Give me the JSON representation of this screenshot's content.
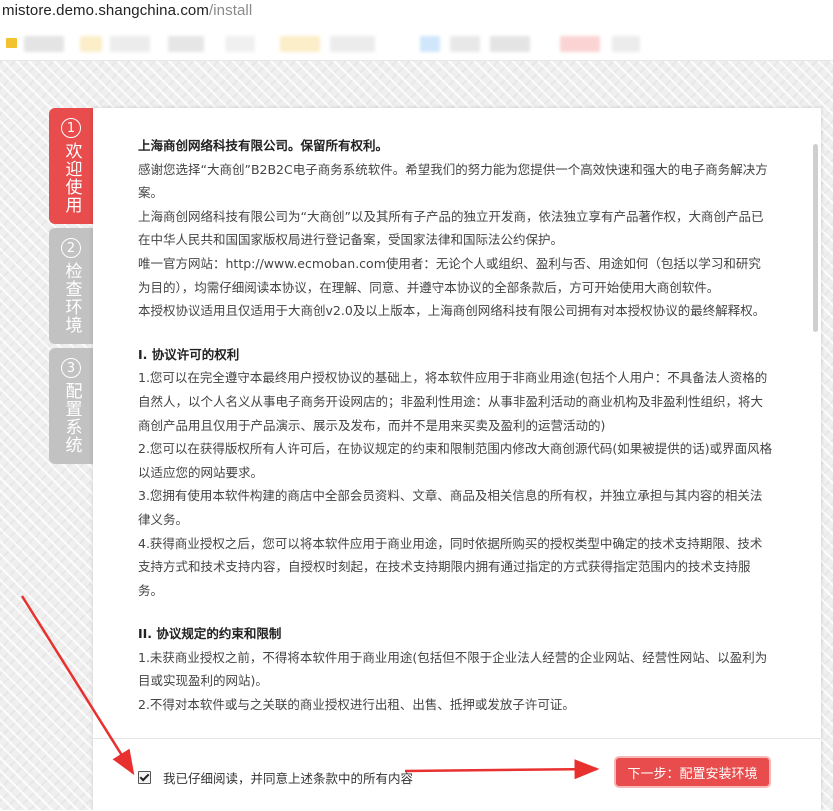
{
  "browser": {
    "url_host": "mistore.demo.shangchina.com",
    "url_path": "/install"
  },
  "steps": [
    {
      "number": "1",
      "label": "欢迎使用",
      "active": true
    },
    {
      "number": "2",
      "label": "检查环境",
      "active": false
    },
    {
      "number": "3",
      "label": "配置系统",
      "active": false
    }
  ],
  "license": {
    "paragraphs": [
      "上海商创网络科技有限公司。保留所有权利。",
      "感谢您选择“大商创”B2B2C电子商务系统软件。希望我们的努力能为您提供一个高效快速和强大的电子商务解决方案。",
      "上海商创网络科技有限公司为“大商创”以及其所有子产品的独立开发商，依法独立享有产品著作权，大商创产品已在中华人民共和国国家版权局进行登记备案，受国家法律和国际法公约保护。",
      "唯一官方网站：http://www.ecmoban.com使用者：无论个人或组织、盈利与否、用途如何（包括以学习和研究为目的），均需仔细阅读本协议，在理解、同意、并遵守本协议的全部条款后，方可开始使用大商创软件。",
      "本授权协议适用且仅适用于大商创v2.0及以上版本，上海商创网络科技有限公司拥有对本授权协议的最终解释权。",
      "I. 协议许可的权利",
      "1.您可以在完全遵守本最终用户授权协议的基础上，将本软件应用于非商业用途(包括个人用户：不具备法人资格的自然人，以个人名义从事电子商务开设网店的；非盈利性用途：从事非盈利活动的商业机构及非盈利性组织，将大商创产品用且仅用于产品演示、展示及发布，而并不是用来买卖及盈利的运营活动的)",
      "2.您可以在获得版权所有人许可后，在协议规定的约束和限制范围内修改大商创源代码(如果被提供的话)或界面风格以适应您的网站要求。",
      "3.您拥有使用本软件构建的商店中全部会员资料、文章、商品及相关信息的所有权，并独立承担与其内容的相关法律义务。",
      "4.获得商业授权之后，您可以将本软件应用于商业用途，同时依据所购买的授权类型中确定的技术支持期限、技术支持方式和技术支持内容，自授权时刻起，在技术支持期限内拥有通过指定的方式获得指定范围内的技术支持服务。",
      "II. 协议规定的约束和限制",
      "1.未获商业授权之前，不得将本软件用于商业用途(包括但不限于企业法人经营的企业网站、经营性网站、以盈利为目或实现盈利的网站)。",
      "2.不得对本软件或与之关联的商业授权进行出租、出售、抵押或发放子许可证。"
    ]
  },
  "footer": {
    "agree_label": "我已仔细阅读，并同意上述条款中的所有内容",
    "agree_checked": true,
    "next_button": "下一步：配置安装环境"
  },
  "colors": {
    "accent": "#e84c4c",
    "inactive_step": "#c2c2c2",
    "annotation_arrow": "#e8312f"
  }
}
